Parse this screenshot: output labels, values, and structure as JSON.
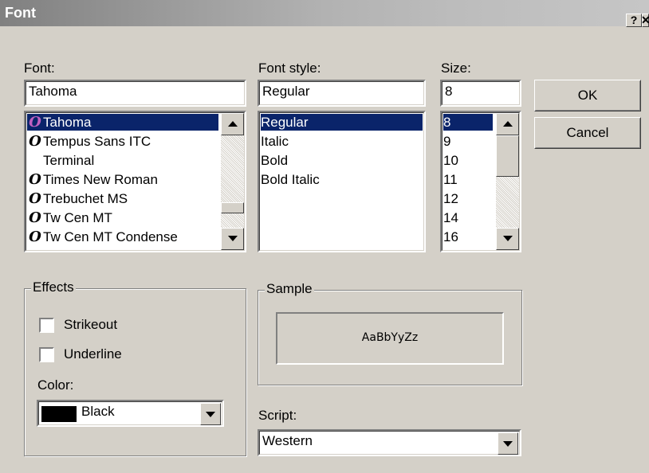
{
  "window": {
    "title": "Font",
    "help_label": "?",
    "close_label": "✕"
  },
  "font": {
    "label": "Font:",
    "value": "Tahoma",
    "items": [
      {
        "name": "Tahoma",
        "icon": "opentype-font-icon",
        "selected": true
      },
      {
        "name": "Tempus Sans ITC",
        "icon": "opentype-font-icon"
      },
      {
        "name": "Terminal",
        "icon": ""
      },
      {
        "name": "Times New Roman",
        "icon": "opentype-font-icon"
      },
      {
        "name": "Trebuchet MS",
        "icon": "opentype-font-icon"
      },
      {
        "name": "Tw Cen MT",
        "icon": "opentype-font-icon"
      },
      {
        "name": "Tw Cen MT Condense",
        "icon": "opentype-font-icon"
      }
    ]
  },
  "style": {
    "label": "Font style:",
    "value": "Regular",
    "items": [
      {
        "name": "Regular",
        "selected": true
      },
      {
        "name": "Italic"
      },
      {
        "name": "Bold"
      },
      {
        "name": "Bold Italic"
      }
    ]
  },
  "size": {
    "label": "Size:",
    "value": "8",
    "items": [
      {
        "name": "8",
        "selected": true
      },
      {
        "name": "9"
      },
      {
        "name": "10"
      },
      {
        "name": "11"
      },
      {
        "name": "12"
      },
      {
        "name": "14"
      },
      {
        "name": "16"
      }
    ]
  },
  "buttons": {
    "ok": "OK",
    "cancel": "Cancel"
  },
  "effects": {
    "title": "Effects",
    "strikeout": "Strikeout",
    "underline": "Underline",
    "color_label": "Color:",
    "color_value": "Black",
    "color_hex": "#000000"
  },
  "sample": {
    "title": "Sample",
    "text": "AaBbYyZz"
  },
  "script": {
    "label": "Script:",
    "value": "Western"
  },
  "colors": {
    "selection": "#0a246a",
    "face": "#d4d0c8"
  }
}
